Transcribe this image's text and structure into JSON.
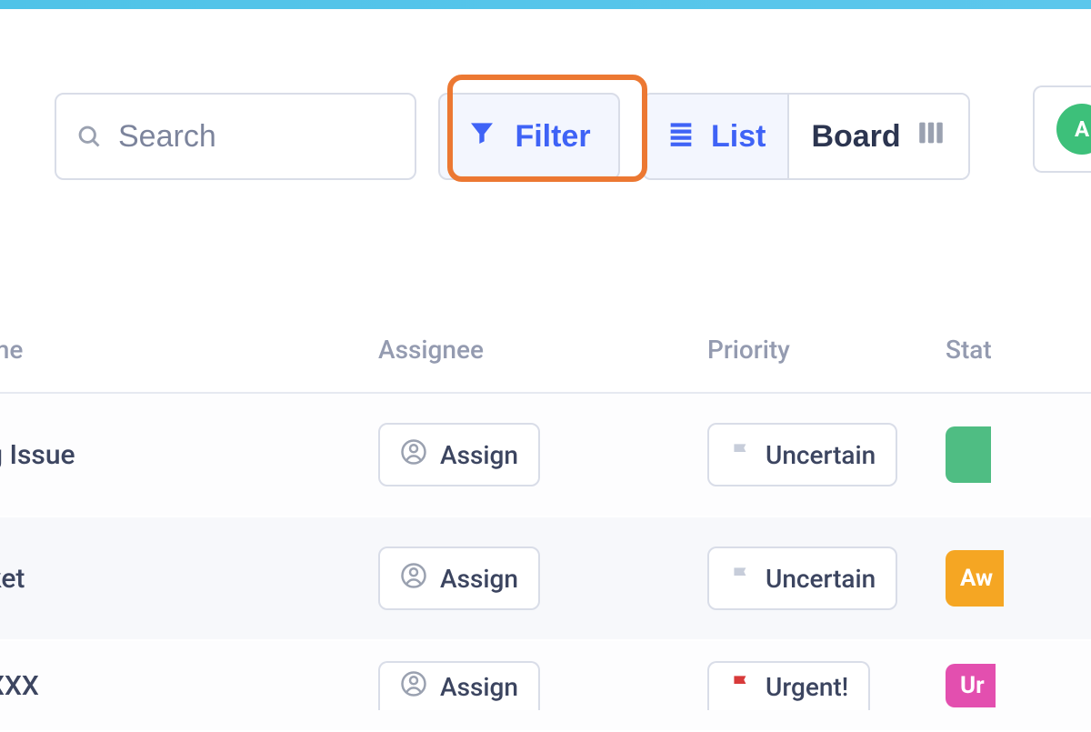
{
  "toolbar": {
    "search_placeholder": "Search",
    "filter_label": "Filter",
    "view_list_label": "List",
    "view_board_label": "Board",
    "avatar_initial": "A"
  },
  "columns": {
    "name": "me",
    "assignee": "Assignee",
    "priority": "Priority",
    "status": "Stat"
  },
  "rows": [
    {
      "name": "g Issue",
      "assign_label": "Assign",
      "priority_label": "Uncertain",
      "priority_flag": "gray",
      "status_text": "",
      "status_color": "green"
    },
    {
      "name": "ket",
      "assign_label": "Assign",
      "priority_label": "Uncertain",
      "priority_flag": "gray",
      "status_text": "Aw",
      "status_color": "orange"
    },
    {
      "name": "XXX",
      "assign_label": "Assign",
      "priority_label": "Urgent!",
      "priority_flag": "red",
      "status_text": "Ur",
      "status_color": "pink"
    }
  ]
}
